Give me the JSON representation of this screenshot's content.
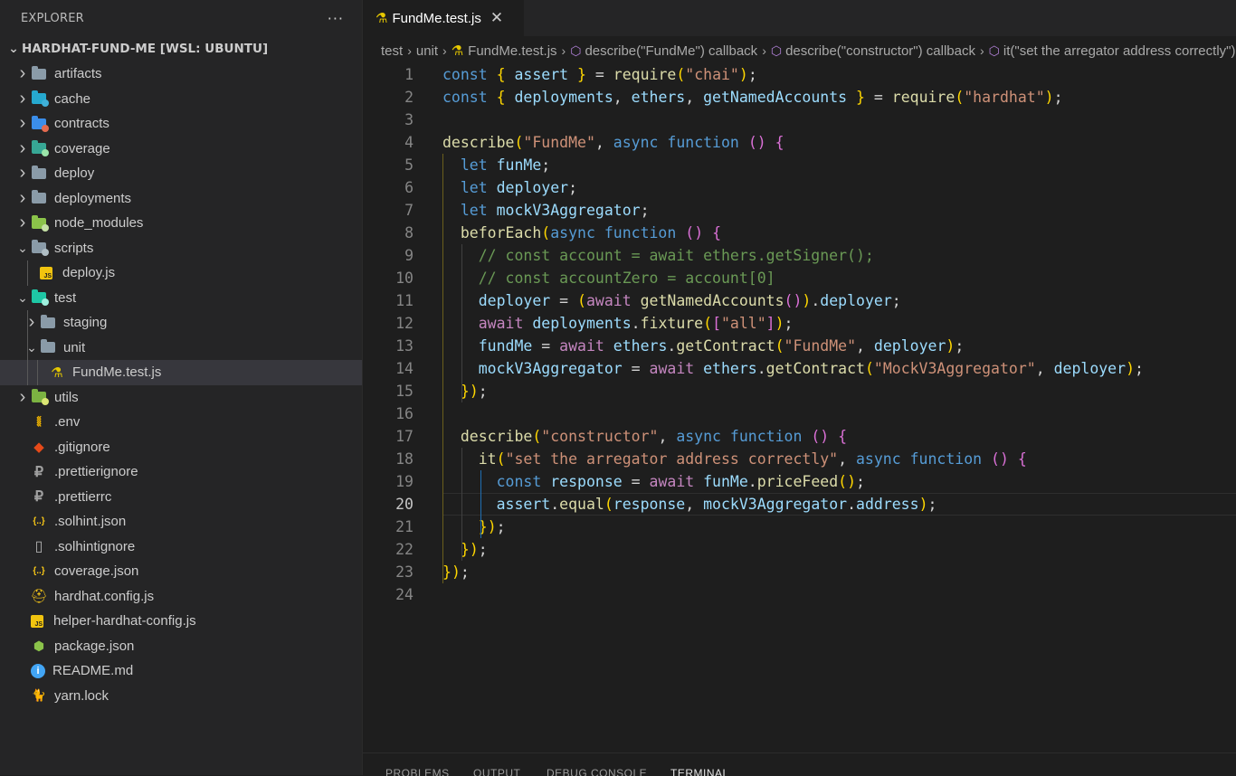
{
  "explorer": {
    "title": "EXPLORER",
    "more": "···",
    "root_label": "HARDHAT-FUND-ME [WSL: UBUNTU]",
    "items": [
      {
        "label": "artifacts",
        "icon": "folder-icon"
      },
      {
        "label": "cache",
        "icon": "folder-cache-icon"
      },
      {
        "label": "contracts",
        "icon": "folder-contracts-icon"
      },
      {
        "label": "coverage",
        "icon": "folder-coverage-icon"
      },
      {
        "label": "deploy",
        "icon": "folder-icon"
      },
      {
        "label": "deployments",
        "icon": "folder-icon"
      },
      {
        "label": "node_modules",
        "icon": "folder-node-icon"
      },
      {
        "label": "scripts",
        "icon": "folder-scripts-icon"
      },
      {
        "label": "deploy.js",
        "icon": "js-file-icon"
      },
      {
        "label": "test",
        "icon": "folder-test-icon"
      },
      {
        "label": "staging",
        "icon": "folder-icon"
      },
      {
        "label": "unit",
        "icon": "folder-open-icon"
      },
      {
        "label": "FundMe.test.js",
        "icon": "test-flask-icon"
      },
      {
        "label": "utils",
        "icon": "folder-utils-icon"
      },
      {
        "label": ".env",
        "icon": "env-icon"
      },
      {
        "label": ".gitignore",
        "icon": "git-icon"
      },
      {
        "label": ".prettierignore",
        "icon": "prettier-icon"
      },
      {
        "label": ".prettierrc",
        "icon": "prettier-icon"
      },
      {
        "label": ".solhint.json",
        "icon": "json-icon"
      },
      {
        "label": ".solhintignore",
        "icon": "file-icon"
      },
      {
        "label": "coverage.json",
        "icon": "json-icon"
      },
      {
        "label": "hardhat.config.js",
        "icon": "hardhat-icon"
      },
      {
        "label": "helper-hardhat-config.js",
        "icon": "js-file-icon"
      },
      {
        "label": "package.json",
        "icon": "node-icon"
      },
      {
        "label": "README.md",
        "icon": "info-icon"
      },
      {
        "label": "yarn.lock",
        "icon": "yarn-icon"
      }
    ]
  },
  "tab": {
    "label": "FundMe.test.js",
    "close": "✕"
  },
  "breadcrumbs": [
    "test",
    "unit",
    "FundMe.test.js",
    "describe(\"FundMe\") callback",
    "describe(\"constructor\") callback",
    "it(\"set the arregator address correctly\") callback"
  ],
  "editor": {
    "active_line": 20,
    "lines": [
      "const { assert } = require(\"chai\");",
      "const { deployments, ethers, getNamedAccounts } = require(\"hardhat\");",
      "",
      "describe(\"FundMe\", async function () {",
      "  let funMe;",
      "  let deployer;",
      "  let mockV3Aggregator;",
      "  beforEach(async function () {",
      "    // const account = await ethers.getSigner();",
      "    // const accountZero = account[0]",
      "    deployer = (await getNamedAccounts()).deployer;",
      "    await deployments.fixture([\"all\"]);",
      "    fundMe = await ethers.getContract(\"FundMe\", deployer);",
      "    mockV3Aggregator = await ethers.getContract(\"MockV3Aggregator\", deployer);",
      "  });",
      "",
      "  describe(\"constructor\", async function () {",
      "    it(\"set the arregator address correctly\", async function () {",
      "      const response = await funMe.priceFeed();",
      "      assert.equal(response, mockV3Aggregator.address);",
      "    });",
      "  });",
      "});",
      ""
    ]
  },
  "panel": {
    "tabs": [
      "PROBLEMS",
      "OUTPUT",
      "DEBUG CONSOLE",
      "TERMINAL"
    ],
    "active": "TERMINAL"
  }
}
